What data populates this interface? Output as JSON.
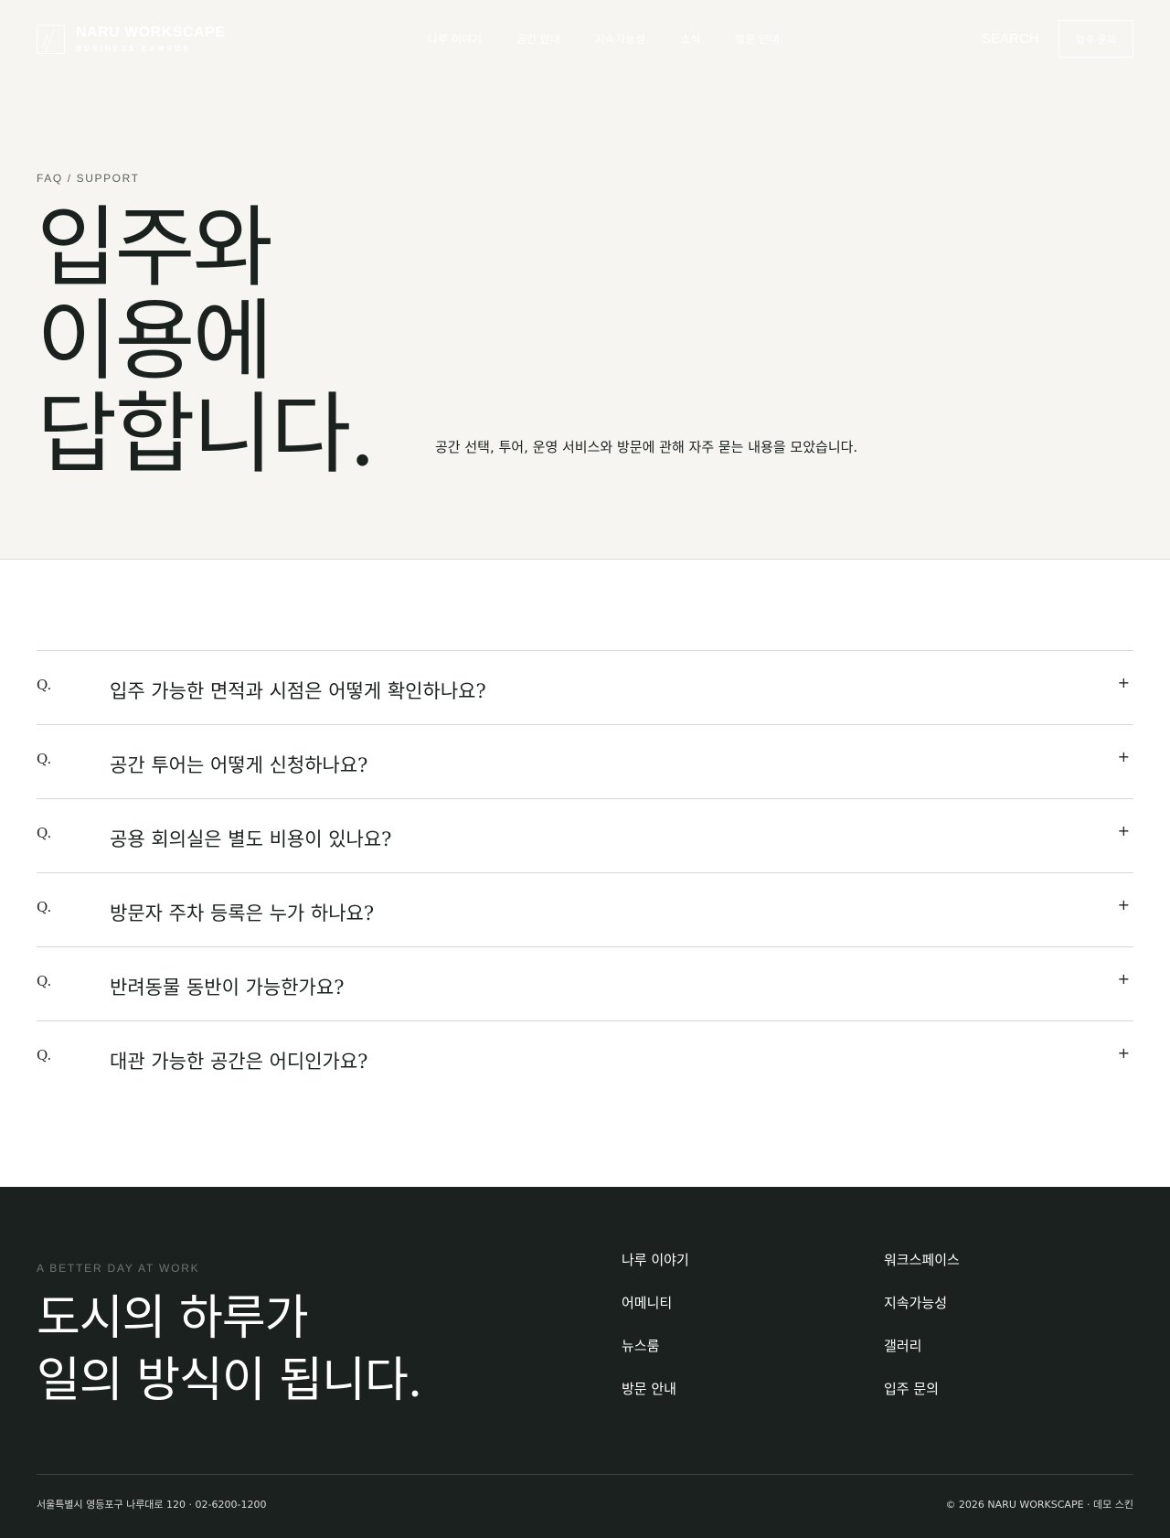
{
  "header": {
    "logo_name": "NARU WORKSCAPE",
    "logo_sub": "BUSINESS CAMPUS",
    "nav": [
      "나루 이야기",
      "공간 안내",
      "지속가능성",
      "소식",
      "방문 안내"
    ],
    "search_label": "SEARCH",
    "cta_label": "입주 문의"
  },
  "hero": {
    "eyebrow": "FAQ / SUPPORT",
    "title_lines": [
      "입주와",
      "이용에",
      "답합니다."
    ],
    "description": "공간 선택, 투어, 운영 서비스와 방문에 관해 자주 묻는 내용을 모았습니다."
  },
  "faq": {
    "q_marker": "Q.",
    "toggle_icon": "+",
    "items": [
      "입주 가능한 면적과 시점은 어떻게 확인하나요?",
      "공간 투어는 어떻게 신청하나요?",
      "공용 회의실은 별도 비용이 있나요?",
      "방문자 주차 등록은 누가 하나요?",
      "반려동물 동반이 가능한가요?",
      "대관 가능한 공간은 어디인가요?"
    ]
  },
  "footer": {
    "eyebrow": "A BETTER DAY AT WORK",
    "title_lines": [
      "도시의 하루가",
      "일의 방식이 됩니다."
    ],
    "links": [
      "나루 이야기",
      "워크스페이스",
      "어메니티",
      "지속가능성",
      "뉴스룸",
      "갤러리",
      "방문 안내",
      "입주 문의"
    ],
    "address": "서울특별시 영등포구 나루대로 120 · 02-6200-1200",
    "copyright": "© 2026 NARU WORKSCAPE · 데모 스킨"
  },
  "colors": {
    "hero_bg": "#f6f5f1",
    "ink": "#1b211f",
    "footer_bg": "#1a211f",
    "rule": "#d6d6d2"
  }
}
